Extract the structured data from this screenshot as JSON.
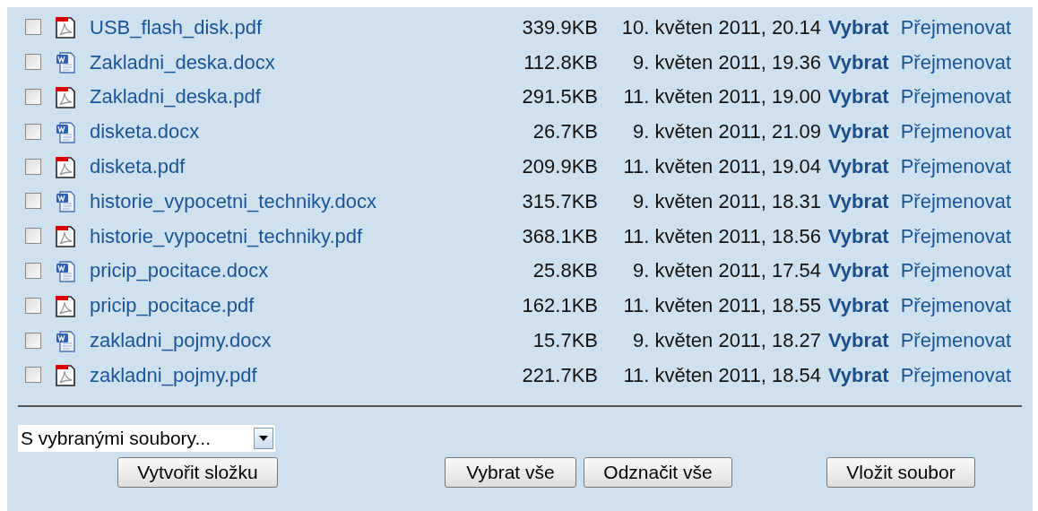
{
  "files": [
    {
      "kind": "pdf",
      "checked": false,
      "name": "USB_flash_disk.pdf",
      "size": "339.9KB",
      "date": "10. květen 2011, 20.14",
      "select": "Vybrat",
      "rename": "Přejmenovat"
    },
    {
      "kind": "docx",
      "checked": false,
      "name": "Zakladni_deska.docx",
      "size": "112.8KB",
      "date": "9. květen 2011, 19.36",
      "select": "Vybrat",
      "rename": "Přejmenovat"
    },
    {
      "kind": "pdf",
      "checked": false,
      "name": "Zakladni_deska.pdf",
      "size": "291.5KB",
      "date": "11. květen 2011, 19.00",
      "select": "Vybrat",
      "rename": "Přejmenovat"
    },
    {
      "kind": "docx",
      "checked": false,
      "name": "disketa.docx",
      "size": "26.7KB",
      "date": "9. květen 2011, 21.09",
      "select": "Vybrat",
      "rename": "Přejmenovat"
    },
    {
      "kind": "pdf",
      "checked": false,
      "name": "disketa.pdf",
      "size": "209.9KB",
      "date": "11. květen 2011, 19.04",
      "select": "Vybrat",
      "rename": "Přejmenovat"
    },
    {
      "kind": "docx",
      "checked": false,
      "name": "historie_vypocetni_techniky.docx",
      "size": "315.7KB",
      "date": "9. květen 2011, 18.31",
      "select": "Vybrat",
      "rename": "Přejmenovat"
    },
    {
      "kind": "pdf",
      "checked": false,
      "name": "historie_vypocetni_techniky.pdf",
      "size": "368.1KB",
      "date": "11. květen 2011, 18.56",
      "select": "Vybrat",
      "rename": "Přejmenovat"
    },
    {
      "kind": "docx",
      "checked": false,
      "name": "pricip_pocitace.docx",
      "size": "25.8KB",
      "date": "9. květen 2011, 17.54",
      "select": "Vybrat",
      "rename": "Přejmenovat"
    },
    {
      "kind": "pdf",
      "checked": false,
      "name": "pricip_pocitace.pdf",
      "size": "162.1KB",
      "date": "11. květen 2011, 18.55",
      "select": "Vybrat",
      "rename": "Přejmenovat"
    },
    {
      "kind": "docx",
      "checked": false,
      "name": "zakladni_pojmy.docx",
      "size": "15.7KB",
      "date": "9. květen 2011, 18.27",
      "select": "Vybrat",
      "rename": "Přejmenovat"
    },
    {
      "kind": "pdf",
      "checked": false,
      "name": "zakladni_pojmy.pdf",
      "size": "221.7KB",
      "date": "11. květen 2011, 18.54",
      "select": "Vybrat",
      "rename": "Přejmenovat"
    }
  ],
  "action_select": {
    "value": "S vybranými soubory..."
  },
  "buttons": [
    "Vytvořit složku",
    "Vybrat vše",
    "Odznačit vše",
    "Vložit soubor"
  ]
}
